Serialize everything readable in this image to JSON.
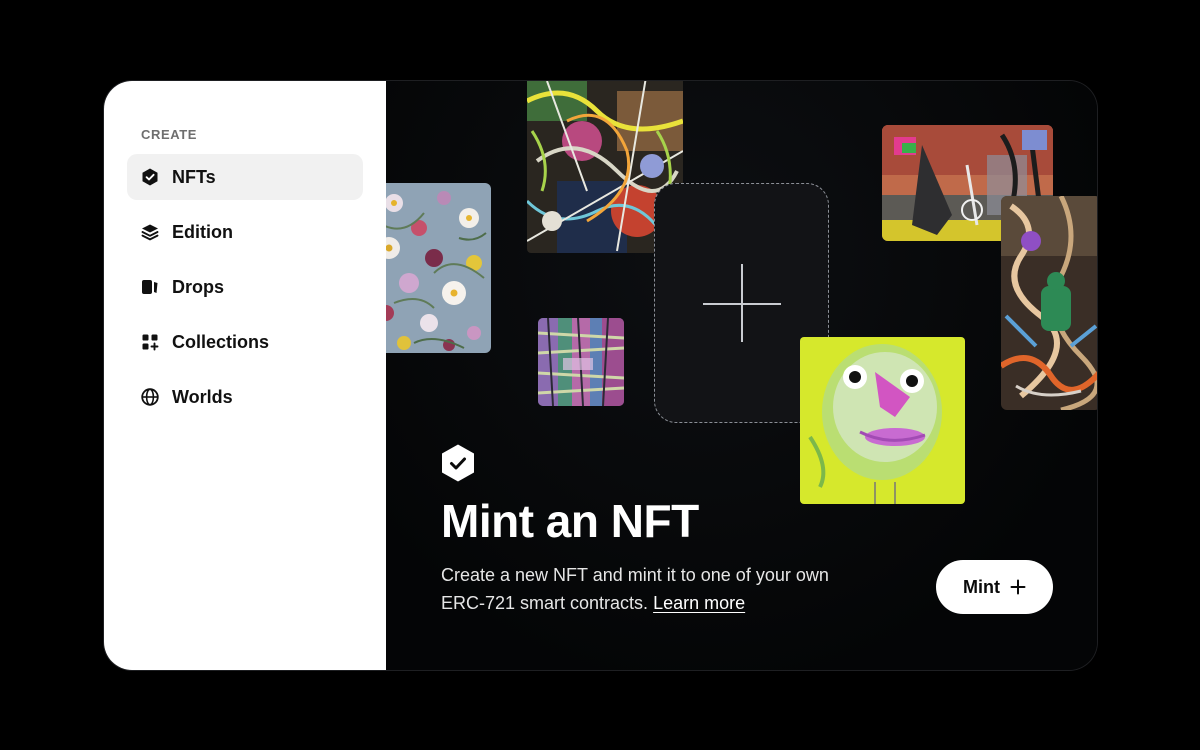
{
  "sidebar": {
    "section_label": "CREATE",
    "items": [
      {
        "label": "NFTs",
        "icon": "shield-check-icon",
        "active": true
      },
      {
        "label": "Edition",
        "icon": "layers-icon",
        "active": false
      },
      {
        "label": "Drops",
        "icon": "drops-icon",
        "active": false
      },
      {
        "label": "Collections",
        "icon": "grid-plus-icon",
        "active": false
      },
      {
        "label": "Worlds",
        "icon": "globe-icon",
        "active": false
      }
    ]
  },
  "hero": {
    "title": "Mint an NFT",
    "description": "Create a new NFT and mint it to one of your own ERC-721 smart contracts.",
    "learn_more": "Learn more",
    "mint_button": "Mint",
    "badge_icon": "shield-check-icon",
    "placeholder_icon": "plus-icon"
  },
  "colors": {
    "page_background": "#000000",
    "sidebar_background": "#ffffff",
    "active_item_background": "#f1f1f1",
    "hero_background": "#050607",
    "accent": "#ffffff"
  }
}
